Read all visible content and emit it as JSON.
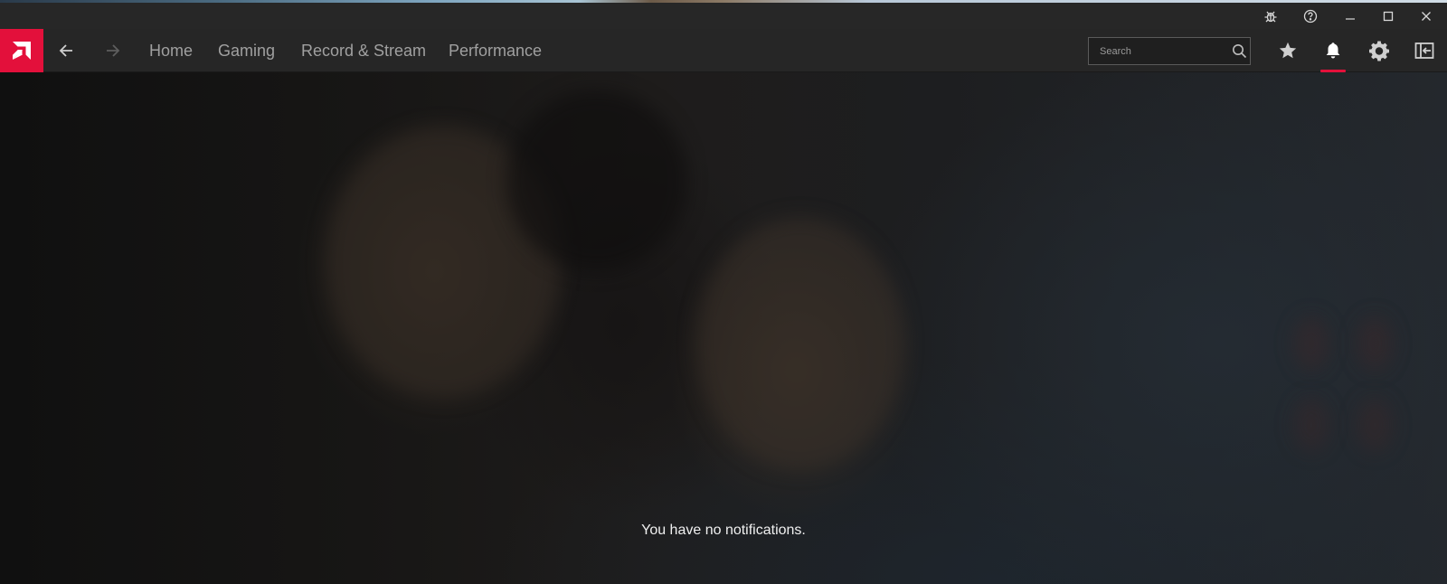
{
  "window": {
    "titlebar_icons": [
      "bug-icon",
      "help-icon",
      "minimize-icon",
      "maximize-icon",
      "close-icon"
    ]
  },
  "nav": {
    "brand": "amd-logo-icon",
    "back_icon": "arrow-left-icon",
    "forward_icon": "arrow-right-icon",
    "links": [
      "Home",
      "Gaming",
      "Record & Stream",
      "Performance"
    ],
    "search": {
      "placeholder": "Search",
      "value": ""
    },
    "right_icons": [
      "star-icon",
      "bell-icon",
      "gear-icon",
      "sidebar-toggle-icon"
    ],
    "active_icon": "bell-icon",
    "accent_color": "#e3103b"
  },
  "notifications": {
    "empty_message": "You have no notifications."
  }
}
